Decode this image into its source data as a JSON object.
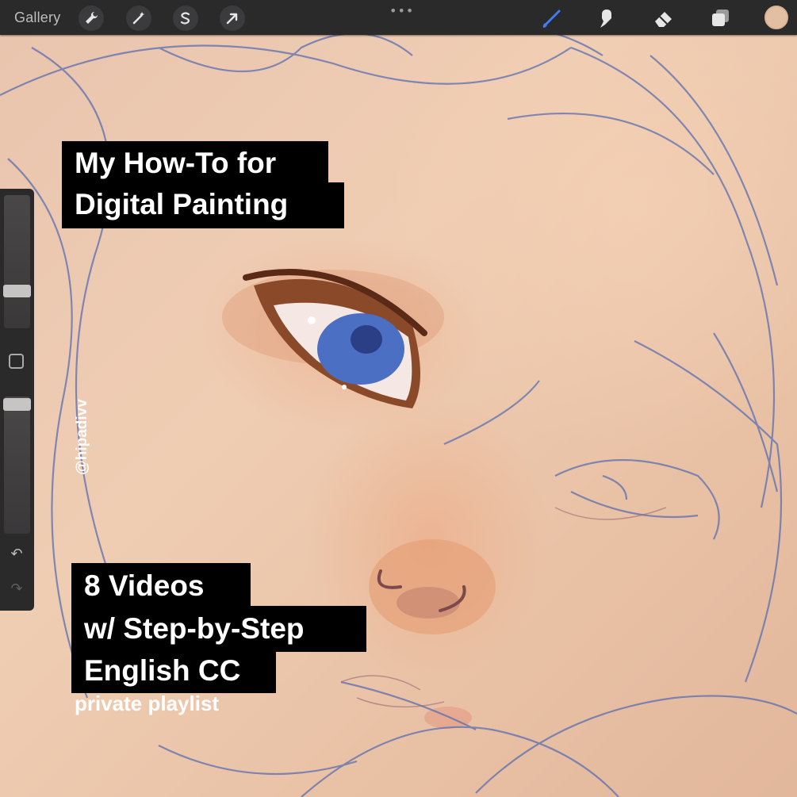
{
  "toolbar": {
    "gallery_label": "Gallery",
    "actions_icon": "wrench-icon",
    "adjustments_icon": "magic-wand-icon",
    "selection_icon": "selection-s-icon",
    "transform_icon": "transform-arrow-icon",
    "more_icon": "•••",
    "brush_icon": "brush-icon",
    "smudge_icon": "smudge-icon",
    "eraser_icon": "eraser-icon",
    "layers_icon": "layers-icon",
    "current_color": "#e2bfa3",
    "brush_accent": "#3f7ef6"
  },
  "sidebar": {
    "brush_size_level": 0.7,
    "opacity_level": 0.95,
    "undo_glyph": "↶",
    "redo_glyph": "↷"
  },
  "captions": {
    "title_line1": "My How-To for",
    "title_line2": "Digital Painting",
    "watermark": "@hipadivv",
    "body_line1": "8 Videos",
    "body_line2": "w/ Step-by-Step",
    "body_line3": "English CC",
    "subtitle": "private playlist"
  }
}
